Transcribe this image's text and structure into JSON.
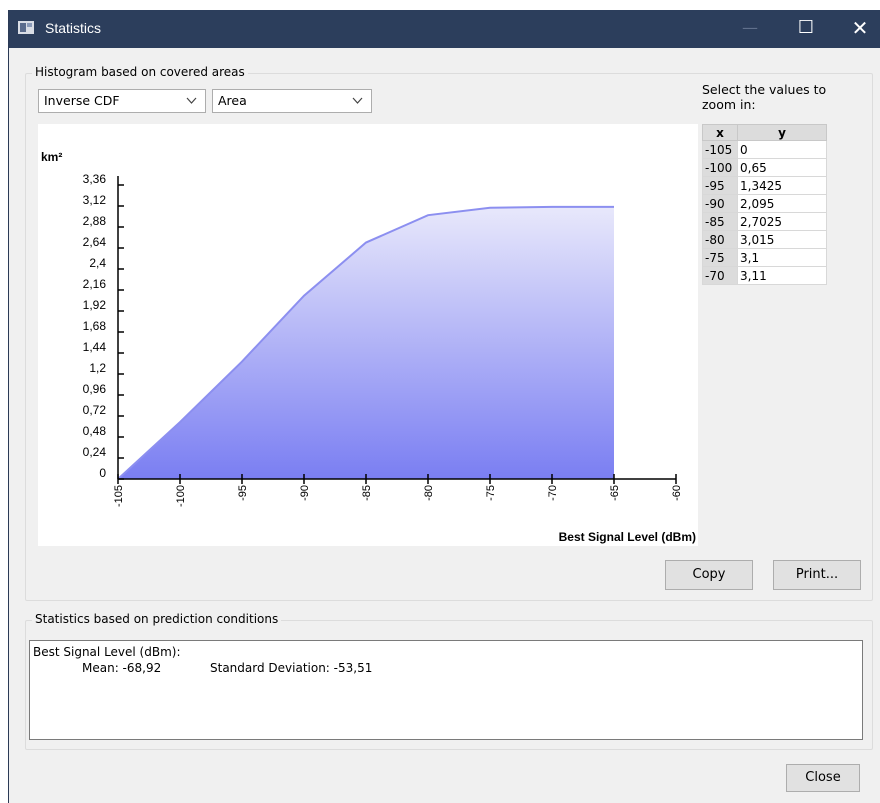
{
  "window": {
    "title": "Statistics"
  },
  "title_buttons": {
    "minimize_icon": "—",
    "maximize_icon": "☐",
    "close_icon": "✕"
  },
  "histogram_group": {
    "label": "Histogram based on covered areas",
    "combo_type": "Inverse CDF",
    "combo_measure": "Area",
    "zoom_hint_line1": "Select the values to",
    "zoom_hint_line2": "zoom in:"
  },
  "table": {
    "headers": [
      "x",
      "y"
    ],
    "rows": [
      [
        "-105",
        "0"
      ],
      [
        "-100",
        "0,65"
      ],
      [
        "-95",
        "1,3425"
      ],
      [
        "-90",
        "2,095"
      ],
      [
        "-85",
        "2,7025"
      ],
      [
        "-80",
        "3,015"
      ],
      [
        "-75",
        "3,1"
      ],
      [
        "-70",
        "3,11"
      ]
    ]
  },
  "buttons": {
    "copy": "Copy",
    "print": "Print...",
    "close": "Close"
  },
  "stats_group": {
    "label": "Statistics based on prediction conditions",
    "line1": "Best Signal Level (dBm):",
    "mean": "Mean: -68,92",
    "stddev": "Standard Deviation: -53,51"
  },
  "chart_data": {
    "type": "area",
    "ylabel": "km²",
    "xlabel": "Best Signal Level (dBm)",
    "x": [
      -105,
      -100,
      -95,
      -90,
      -85,
      -80,
      -75,
      -70,
      -65
    ],
    "y": [
      0,
      0.65,
      1.3425,
      2.095,
      2.7025,
      3.015,
      3.1,
      3.11,
      3.11
    ],
    "xticks": [
      "-105",
      "-100",
      "-95",
      "-90",
      "-85",
      "-80",
      "-75",
      "-70",
      "-65",
      "-60"
    ],
    "yticks": [
      "0",
      "0,24",
      "0,48",
      "0,72",
      "0,96",
      "1,2",
      "1,44",
      "1,68",
      "1,92",
      "2,16",
      "2,4",
      "2,64",
      "2,88",
      "3,12",
      "3,36"
    ],
    "xlim": [
      -105,
      -60
    ],
    "ylim": [
      0,
      3.36
    ],
    "fill_top": "#e8e8fb",
    "fill_bottom": "#7a7ef2",
    "line_color": "#8c8ff0"
  }
}
